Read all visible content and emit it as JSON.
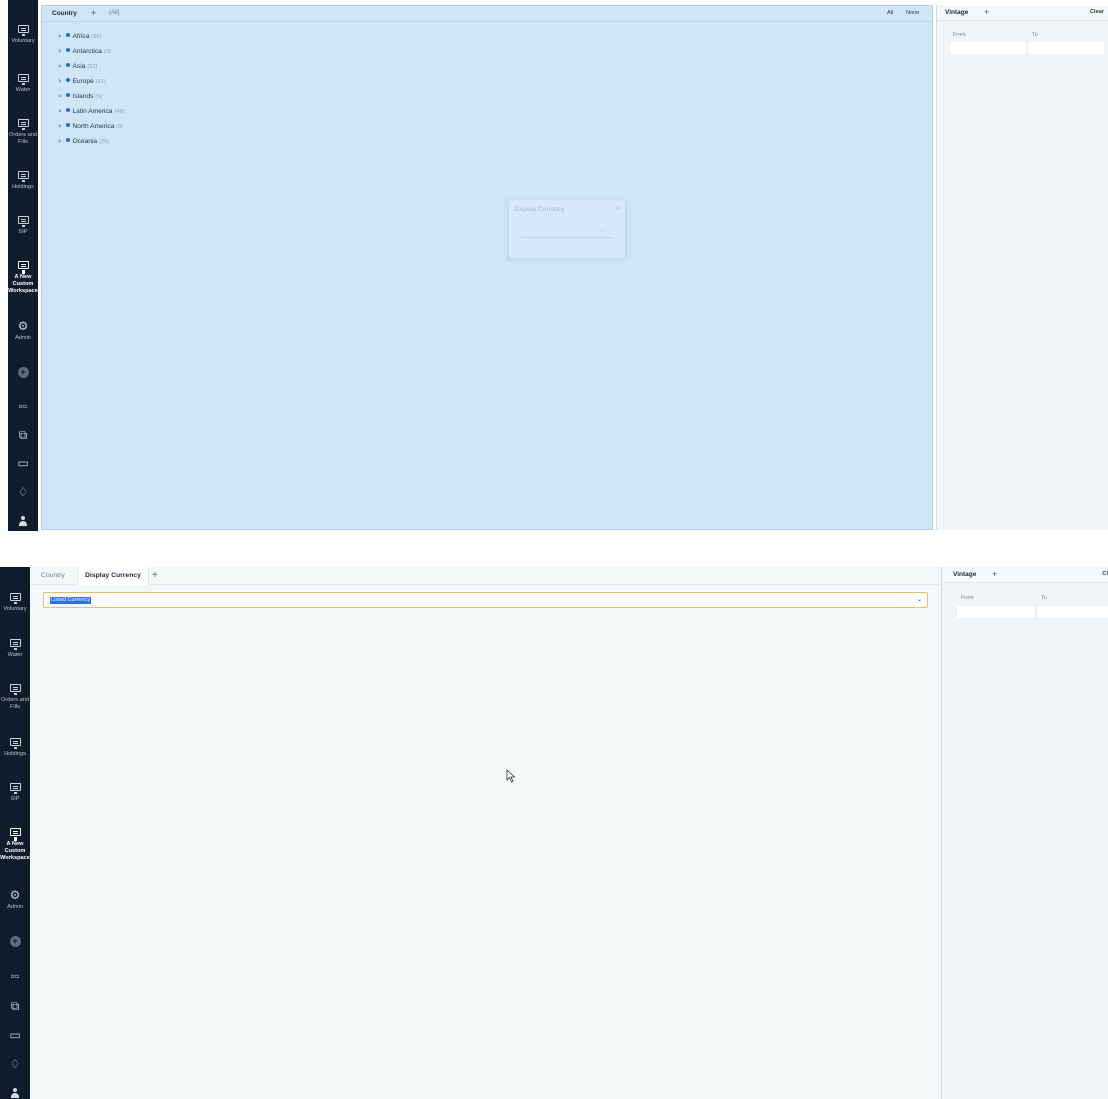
{
  "sidebar": {
    "items": [
      {
        "label": "Voluntary"
      },
      {
        "label": "Water"
      },
      {
        "label": "Orders and Fills"
      },
      {
        "label": "Holdings"
      },
      {
        "label": "SIP"
      },
      {
        "label": "A New Custom Workspace"
      },
      {
        "label": "Admin"
      }
    ],
    "icons": [
      "settings-gear-icon",
      "add-circle-icon",
      "apps-grid-icon",
      "windows-icon",
      "chat-icon",
      "bell-icon",
      "user-icon"
    ]
  },
  "frame1": {
    "tab_label": "Country",
    "tab_add": "+",
    "all_tag": "(All)",
    "btn_all": "All",
    "btn_none": "None",
    "tree": [
      {
        "name": "Africa",
        "count": "(56)"
      },
      {
        "name": "Antarctica",
        "count": "(3)"
      },
      {
        "name": "Asia",
        "count": "(51)"
      },
      {
        "name": "Europe",
        "count": "(51)"
      },
      {
        "name": "Islands",
        "count": "(6)"
      },
      {
        "name": "Latin America",
        "count": "(49)"
      },
      {
        "name": "North America",
        "count": "(3)"
      },
      {
        "name": "Oceania",
        "count": "(26)"
      }
    ],
    "drag_ghost": {
      "title": "Display Currency",
      "close": "×"
    }
  },
  "vintage": {
    "title": "Vintage",
    "add": "+",
    "clear": "Clear",
    "clear_cropped": "Cl",
    "from_label": "From",
    "to_label": "To"
  },
  "frame2": {
    "tabs": [
      {
        "label": "Country"
      },
      {
        "label": "Display Currency"
      }
    ],
    "tab_add": "+",
    "select_value": "Listed Currency"
  },
  "colors": {
    "sidebar_bg": "#0f1c2b",
    "highlight_blue": "#d0e5f8",
    "selection_blue": "#2c74d8",
    "focus_border": "#e6c06e"
  }
}
